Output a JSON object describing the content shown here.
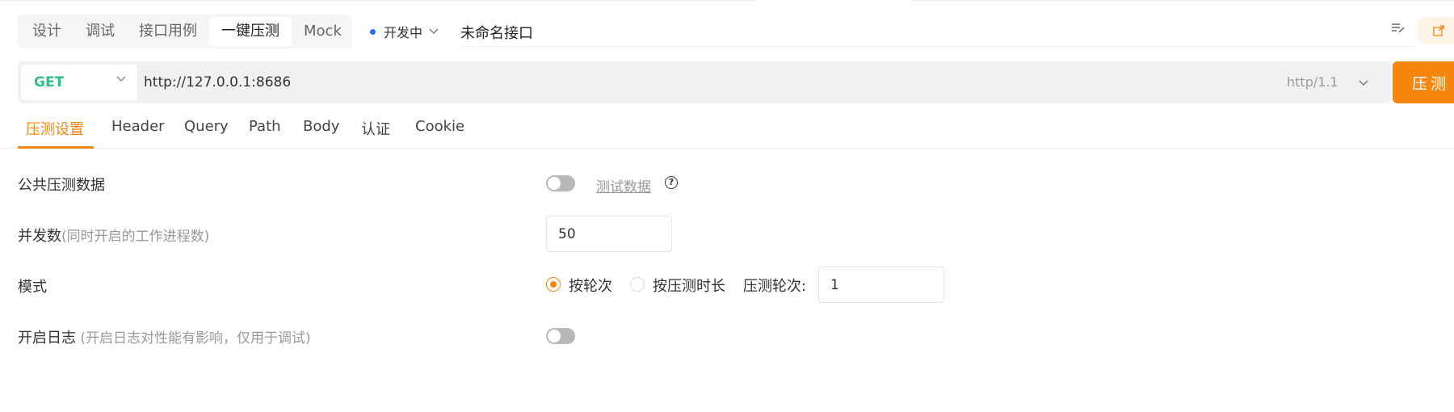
{
  "mode_tabs": [
    {
      "label": "设计"
    },
    {
      "label": "调试"
    },
    {
      "label": "接口用例"
    },
    {
      "label": "一键压测",
      "active": true
    },
    {
      "label": "Mock"
    }
  ],
  "status": {
    "label": "开发中",
    "color": "#2f6bff"
  },
  "api_name": "未命名接口",
  "icons": {
    "edit": "edit-list-icon",
    "share": "share-icon",
    "dropdown": "chevron-down-icon",
    "help": "question-circle-icon"
  },
  "request": {
    "method": "GET",
    "method_color": "#2fbf8a",
    "url": "http://127.0.0.1:8686",
    "protocol": "http/1.1",
    "run_label": "压测",
    "accent": "#f5870f"
  },
  "sub_tabs": [
    {
      "label": "压测设置",
      "active": true
    },
    {
      "label": "Header"
    },
    {
      "label": "Query"
    },
    {
      "label": "Path"
    },
    {
      "label": "Body"
    },
    {
      "label": "认证"
    },
    {
      "label": "Cookie"
    }
  ],
  "settings": {
    "public_data": {
      "label": "公共压测数据",
      "enabled": false,
      "link": "测试数据"
    },
    "concurrency": {
      "label": "并发数",
      "hint": "(同时开启的工作进程数)",
      "value": "50"
    },
    "mode": {
      "label": "模式",
      "options": [
        {
          "label": "按轮次",
          "checked": true
        },
        {
          "label": "按压测时长",
          "checked": false
        }
      ],
      "rounds_label": "压测轮次:",
      "rounds_value": "1"
    },
    "log": {
      "label": "开启日志",
      "hint": " (开启日志对性能有影响，仅用于调试)",
      "enabled": false
    }
  }
}
